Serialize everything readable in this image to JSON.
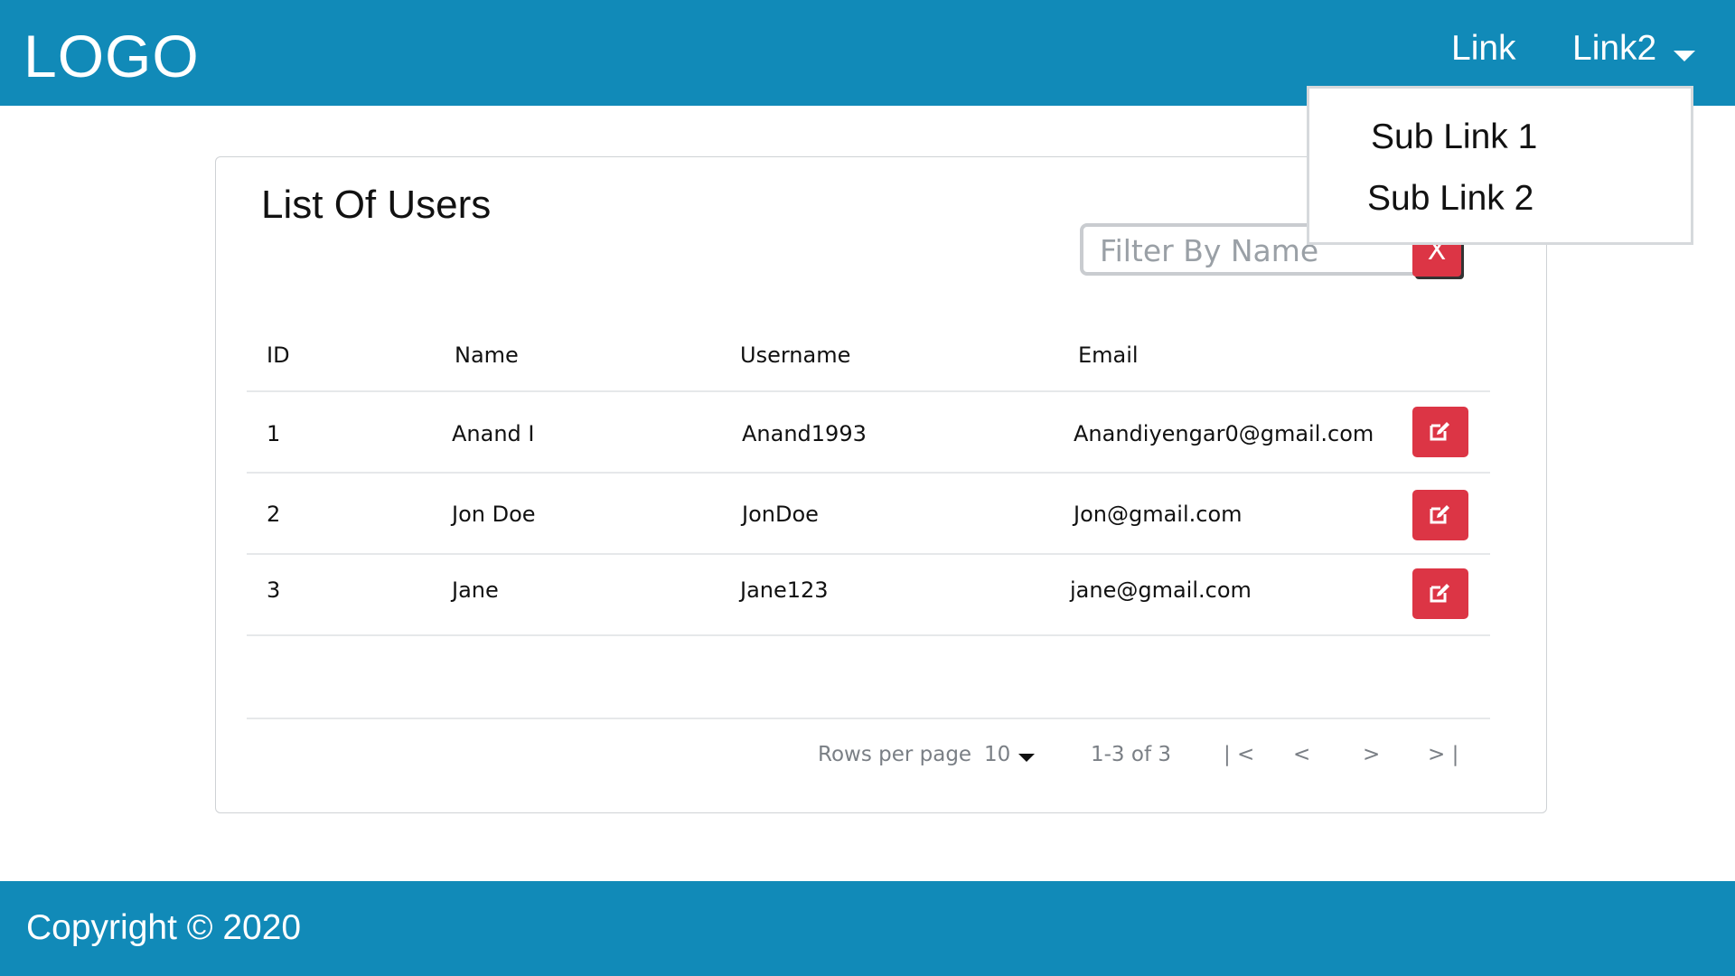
{
  "header": {
    "logo": "LOGO",
    "nav": [
      {
        "label": "Link"
      },
      {
        "label": "Link2"
      }
    ],
    "dropdown": {
      "items": [
        {
          "label": "Sub Link 1"
        },
        {
          "label": "Sub Link 2"
        }
      ]
    }
  },
  "card": {
    "title": "List Of Users",
    "filter": {
      "placeholder": "Filter By Name",
      "value": ""
    },
    "clear_label": "X",
    "table": {
      "headers": [
        "ID",
        "Name",
        "Username",
        "Email"
      ],
      "rows": [
        {
          "id": "1",
          "name": "Anand I",
          "username": "Anand1993",
          "email": "Anandiyengar0@gmail.com"
        },
        {
          "id": "2",
          "name": "Jon Doe",
          "username": "JonDoe",
          "email": "Jon@gmail.com"
        },
        {
          "id": "3",
          "name": "Jane",
          "username": "Jane123",
          "email": "jane@gmail.com"
        }
      ],
      "row_action_icon": "edit-icon"
    },
    "pagination": {
      "rows_per_page_label": "Rows per page",
      "rows_per_page_value": "10",
      "range": "1-3 of 3",
      "first": "| <",
      "prev": "<",
      "next": ">",
      "last": "> |"
    }
  },
  "footer": {
    "copyright": "Copyright © 2020"
  },
  "colors": {
    "brand": "#118ab8",
    "danger": "#dc3545"
  }
}
